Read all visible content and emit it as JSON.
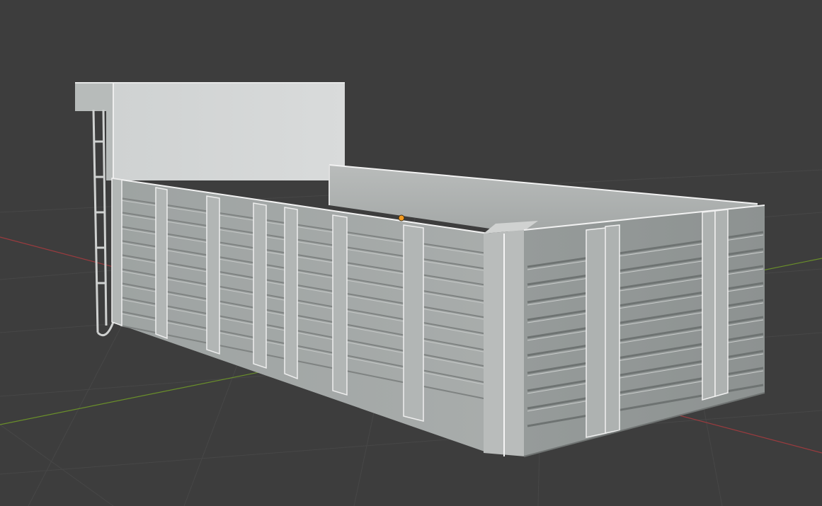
{
  "viewport": {
    "background": "#3d3d3d",
    "grid_color": "#474747",
    "x_axis_color": "#9a3b3e",
    "y_axis_color": "#6a8f2a",
    "origin_color": "#f29a20"
  },
  "model": {
    "name": "container",
    "base_color": "#a9acab",
    "highlight_color": "#f2f2f2",
    "shadow_color": "#7f8382"
  },
  "icons": {
    "origin": "origin-dot-icon"
  }
}
